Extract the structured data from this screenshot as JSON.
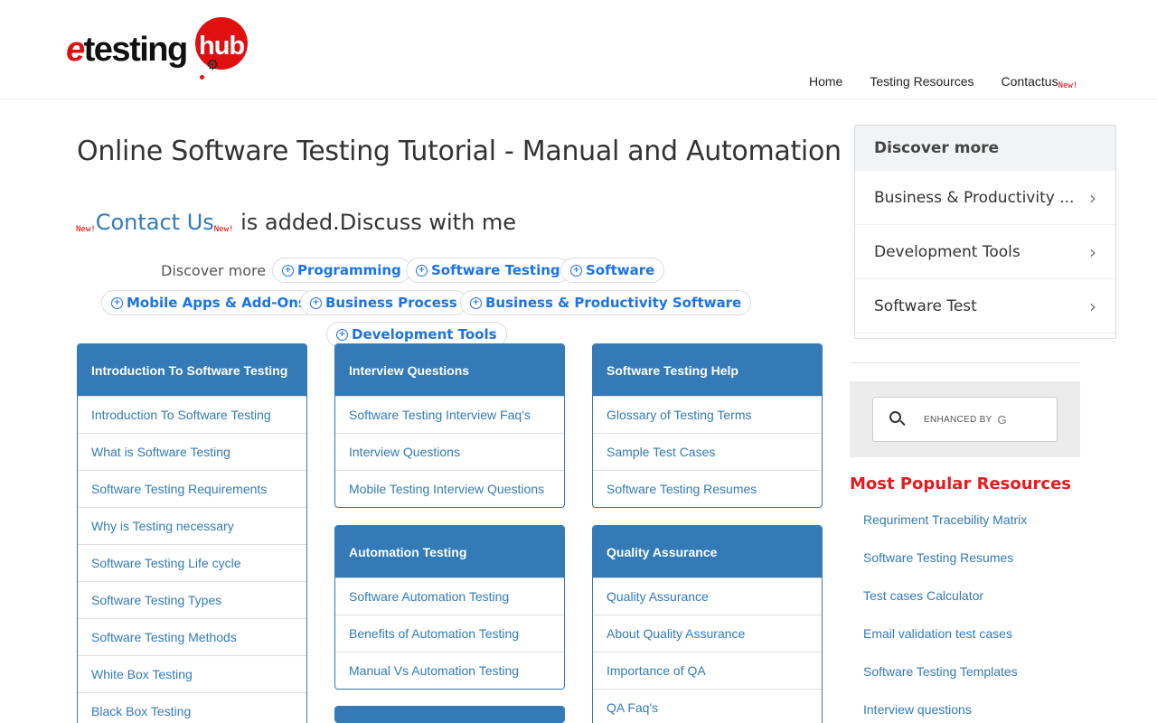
{
  "brand": {
    "name_part1": "e",
    "name_part2": "testing",
    "name_part3": "hub"
  },
  "nav": {
    "items": [
      "Home",
      "Testing Resources",
      "Contactus"
    ],
    "new_tag": "New!"
  },
  "page_title": "Online Software Testing Tutorial - Manual and Automation",
  "announcement": {
    "new_tag": "New!",
    "link_text": "Contact Us",
    "suffix": " is added.Discuss with me"
  },
  "discover_chips": {
    "label": "Discover more",
    "items": [
      "Programming",
      "Software Testing",
      "Software",
      "Mobile Apps & Add-Ons",
      "Business Process",
      "Business & Productivity Software",
      "Development Tools"
    ]
  },
  "panels": {
    "intro": {
      "title": "Introduction To Software Testing",
      "items": [
        "Introduction To Software Testing",
        "What is Software Testing",
        "Software Testing Requirements",
        "Why is Testing necessary",
        "Software Testing Life cycle",
        "Software Testing Types",
        "Software Testing Methods",
        "White Box Testing",
        "Black Box Testing"
      ]
    },
    "interview": {
      "title": "Interview Questions",
      "items": [
        "Software Testing Interview Faq's",
        "Interview Questions",
        "Mobile Testing Interview Questions"
      ]
    },
    "automation": {
      "title": "Automation Testing",
      "items": [
        "Software Automation Testing",
        "Benefits of Automation Testing",
        "Manual Vs Automation Testing"
      ]
    },
    "help": {
      "title": "Software Testing Help",
      "items": [
        "Glossary of Testing Terms",
        "Sample Test Cases",
        "Software Testing Resumes"
      ]
    },
    "qa": {
      "title": "Quality Assurance",
      "items": [
        "Quality Assurance",
        "About Quality Assurance",
        "Importance of QA",
        "QA Faq's"
      ]
    }
  },
  "sidebar": {
    "discover": {
      "title": "Discover more",
      "items": [
        "Business & Productivity ...",
        "Development Tools",
        "Software Test"
      ]
    },
    "search": {
      "enhanced_label": "ENHANCED BY",
      "g_glyph": "G"
    },
    "popular": {
      "title": "Most Popular Resources",
      "items": [
        "Requriment Tracebility Matrix",
        "Software Testing Resumes",
        "Test cases Calculator",
        "Email validation test cases",
        "Software Testing Templates",
        "Interview questions"
      ]
    }
  },
  "colors": {
    "brand_red": "#e01010",
    "panel_blue": "#337ab7",
    "chip_blue": "#1a73e8"
  }
}
